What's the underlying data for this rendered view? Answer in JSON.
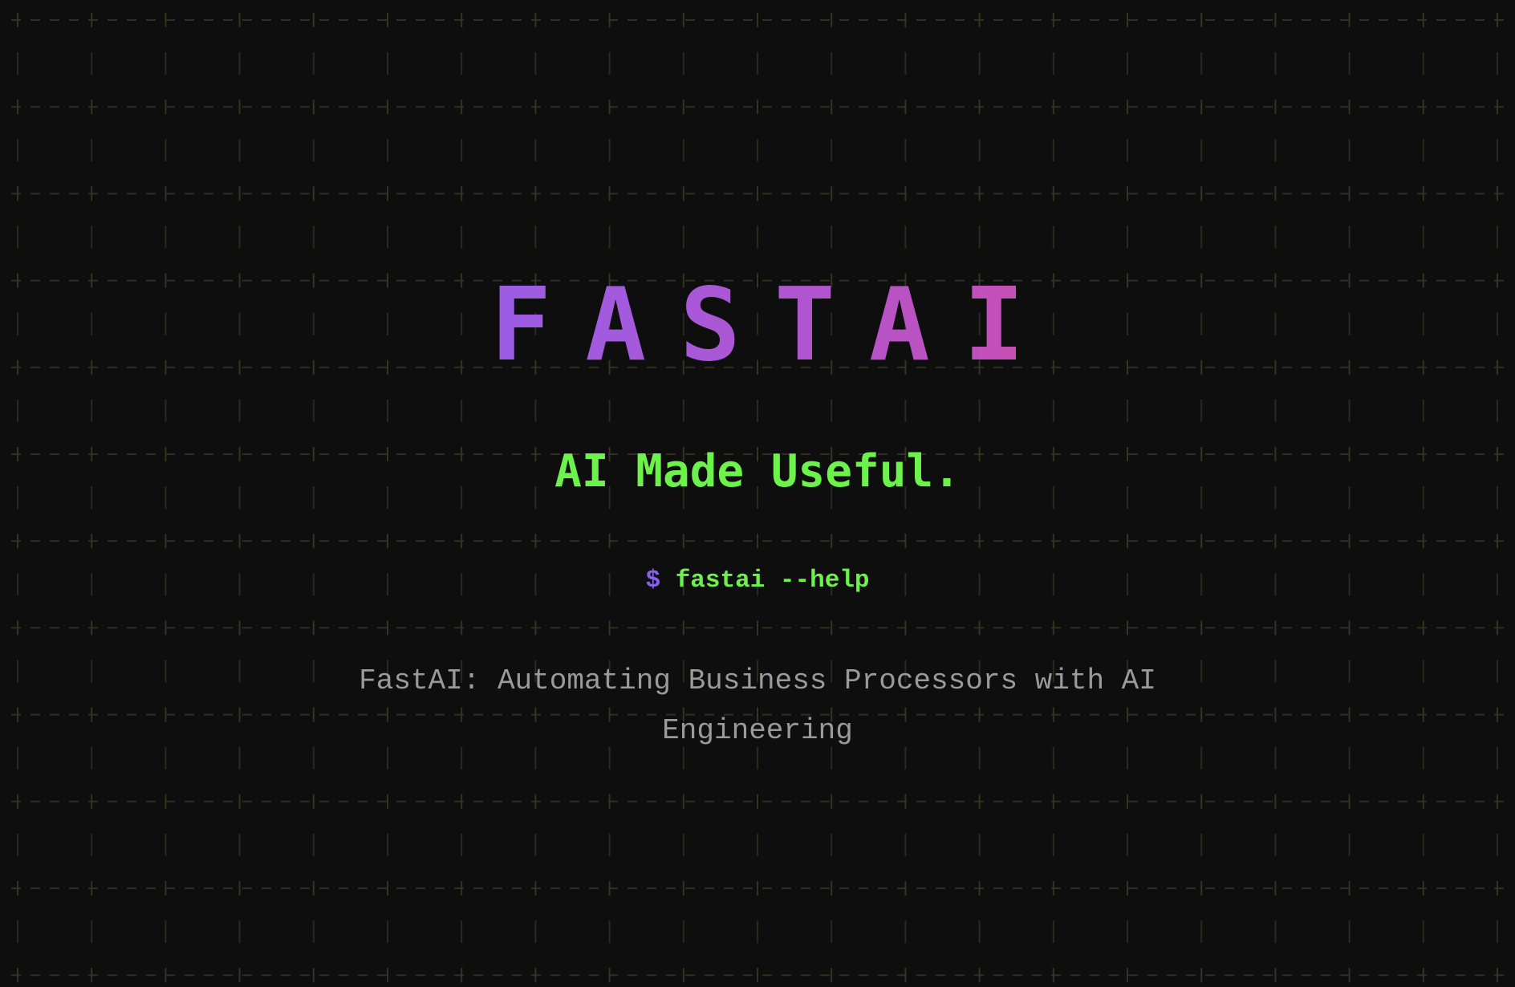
{
  "hero": {
    "logo": "FASTAI",
    "tagline": "AI Made Useful.",
    "command_prompt": "$",
    "command_text": "fastai --help",
    "description": "FastAI: Automating Business Processors with AI Engineering"
  },
  "colors": {
    "background": "#0e0e0e",
    "logo_gradient_start": "#9b5de5",
    "logo_gradient_end": "#c94fb0",
    "accent_green": "#6cf24a",
    "prompt_purple": "#8b5cf6",
    "description_gray": "#9a9a9a",
    "grid_line": "#2f3020"
  }
}
